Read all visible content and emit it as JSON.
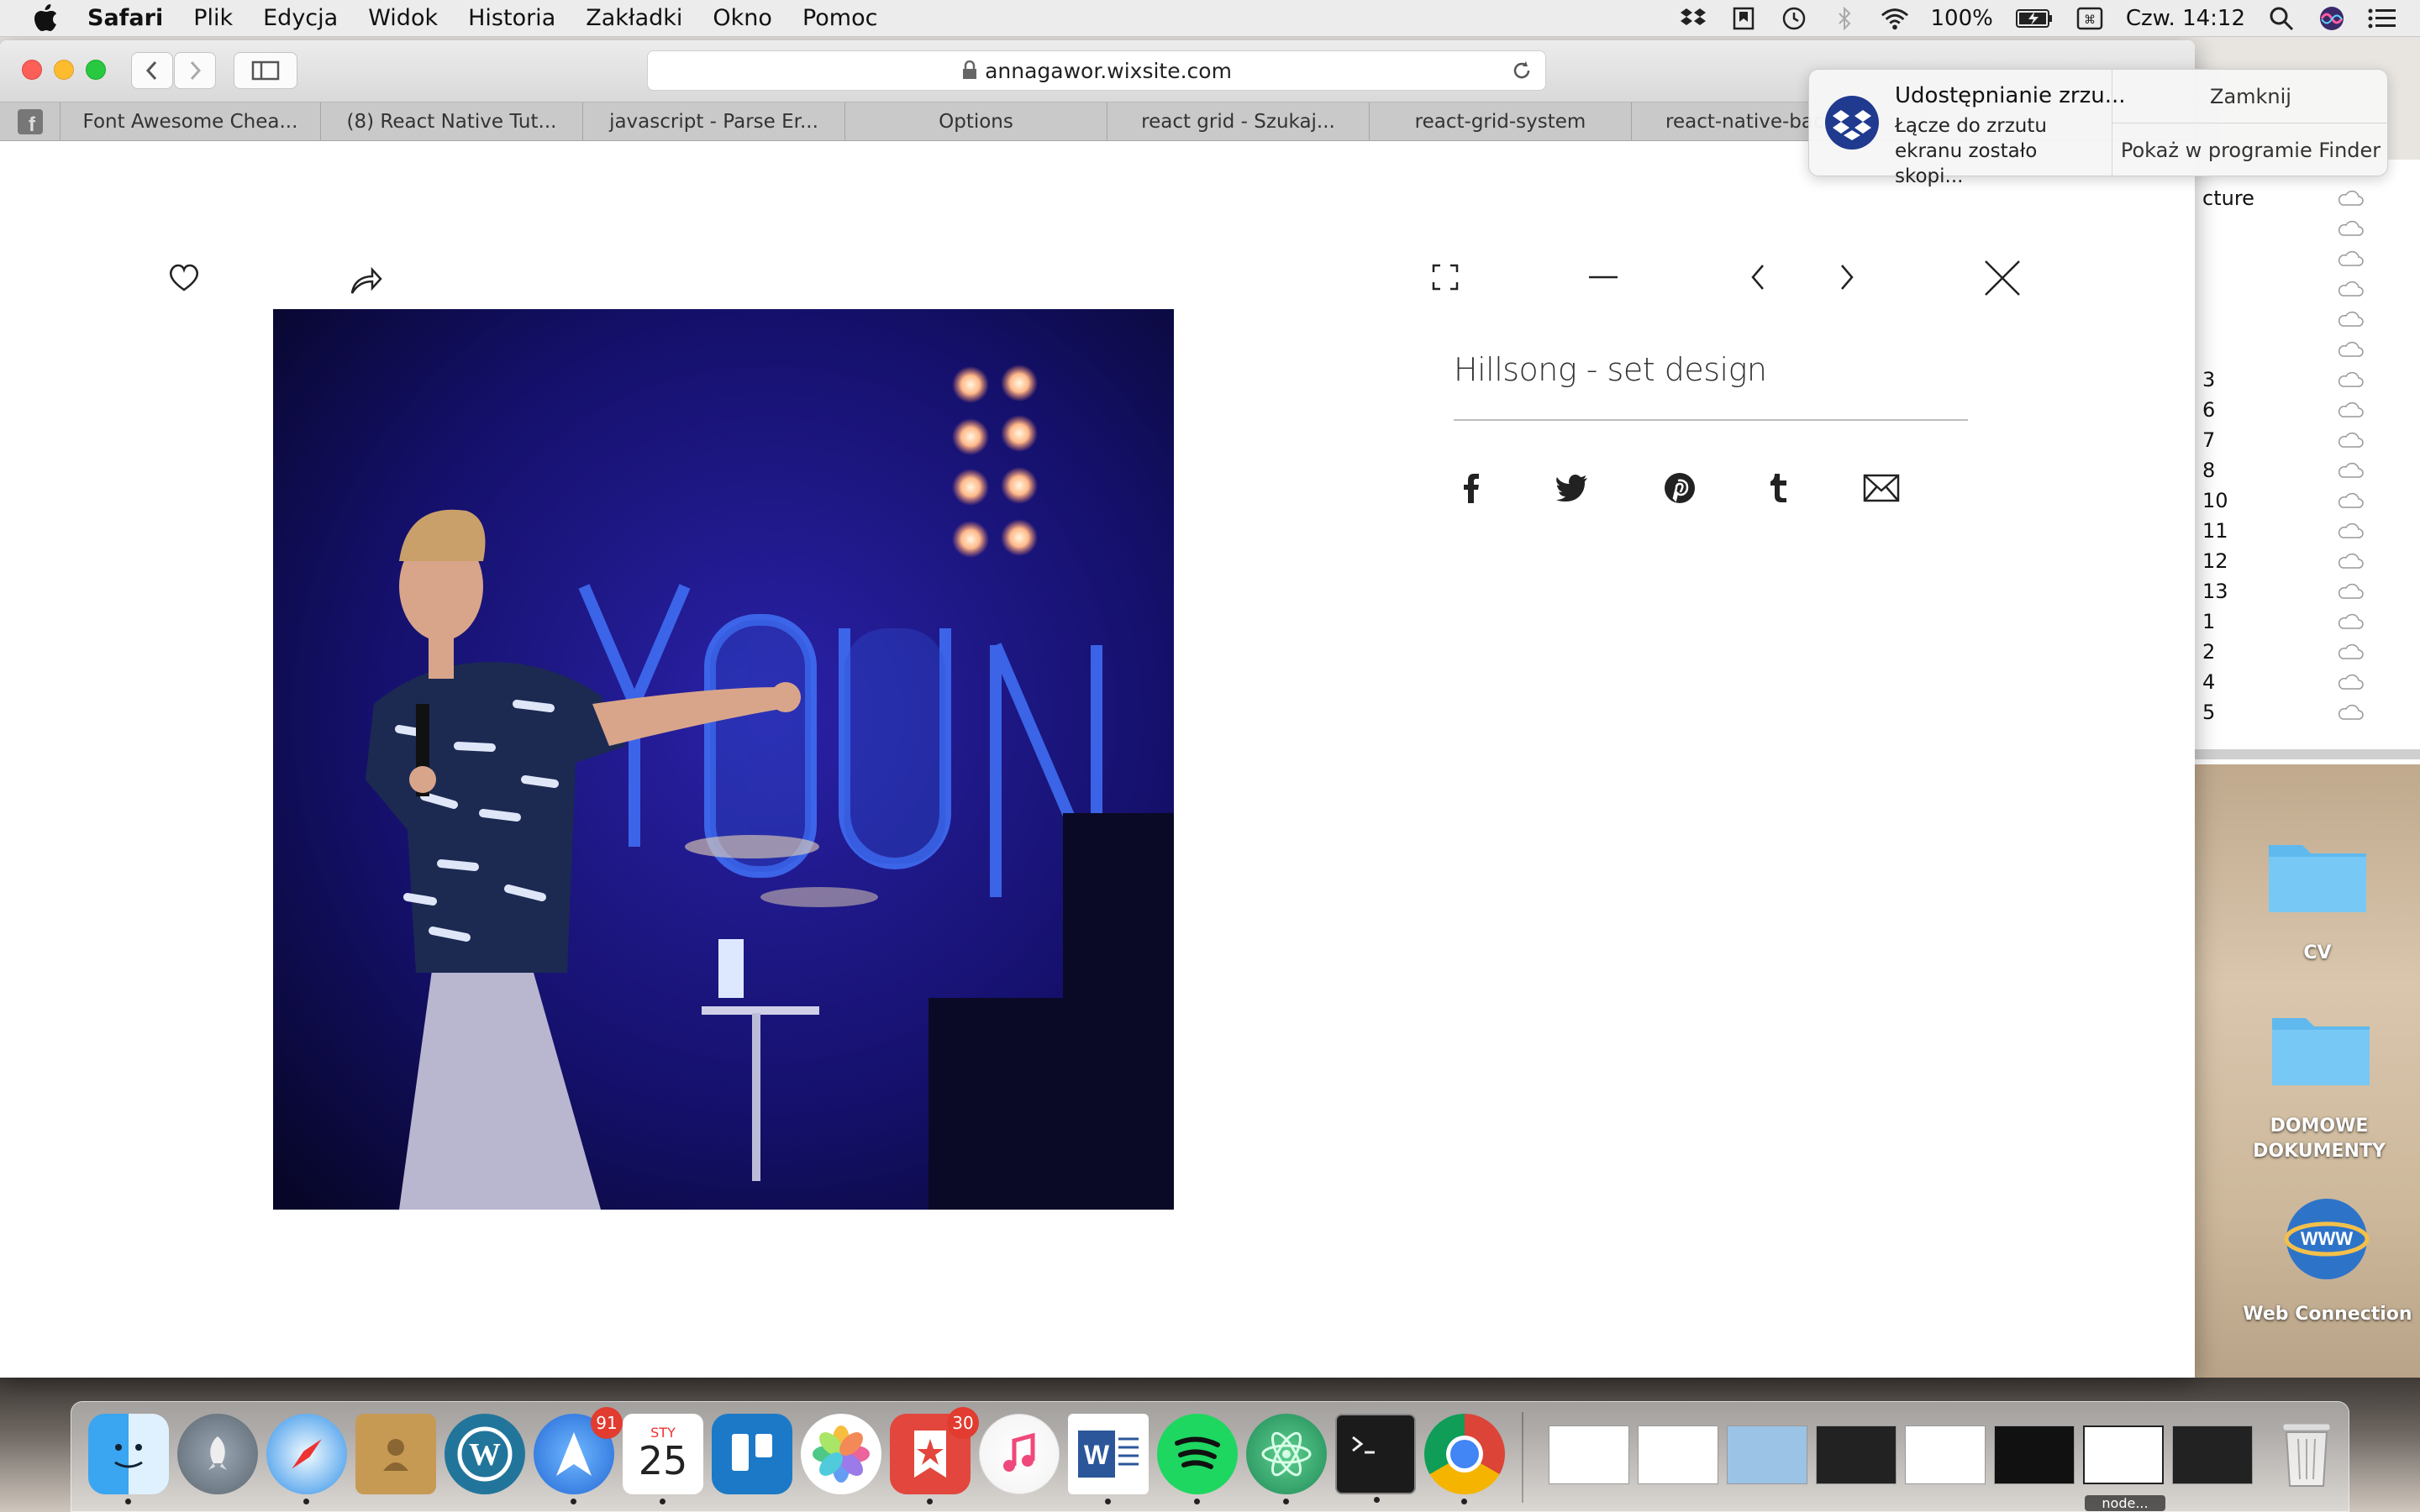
{
  "menubar": {
    "app_name": "Safari",
    "menus": [
      "Plik",
      "Edycja",
      "Widok",
      "Historia",
      "Zakładki",
      "Okno",
      "Pomoc"
    ],
    "battery": "100%",
    "clock": "Czw. 14:12"
  },
  "browser": {
    "url": "annagawor.wixsite.com",
    "tabs": [
      "Font Awesome Chea...",
      "(8) React Native Tut...",
      "javascript - Parse Er...",
      "Options",
      "react grid - Szukaj...",
      "react-grid-system",
      "react-native-bac"
    ]
  },
  "lightbox": {
    "title": "Hillsong - set design",
    "share_icons": [
      "facebook-icon",
      "twitter-icon",
      "pinterest-icon",
      "tumblr-icon",
      "mail-icon"
    ]
  },
  "notification": {
    "title": "Udostępnianie zrzu...",
    "body": "Łącze do zrzutu ekranu zostało skopi...",
    "close_label": "Zamknij",
    "finder_label": "Pokaż w programie Finder"
  },
  "finder": {
    "header": "cture",
    "rows": [
      "3",
      "6",
      "7",
      "8",
      "10",
      "11",
      "12",
      "13",
      "1",
      "2",
      "4",
      "5"
    ]
  },
  "desktop": {
    "icons": [
      "CV",
      "DOMOWE DOKUMENTY",
      "Web Connection"
    ]
  },
  "dock": {
    "calendar_month": "STY",
    "calendar_day": "25",
    "badges": {
      "spark": "91",
      "wunderlist": "30"
    },
    "terminal_label": "node..."
  },
  "colors": {
    "accent_blue": "#1d5fbf",
    "dock_badge": "#e23b30",
    "stage_blue": "#1a1470"
  }
}
